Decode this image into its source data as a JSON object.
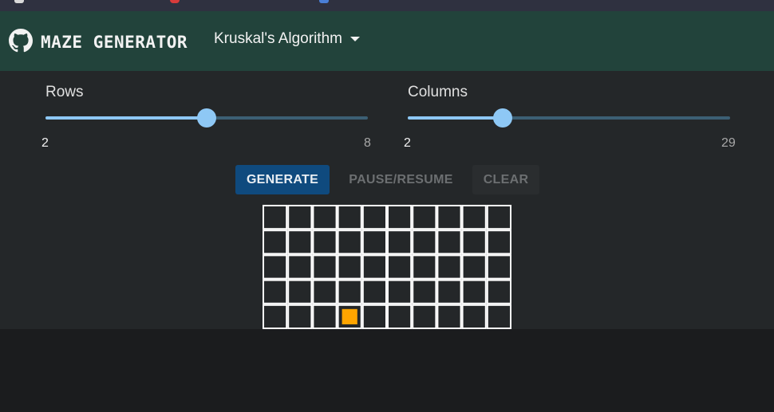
{
  "browser": {
    "tab_icons": [
      {
        "name": "page-icon",
        "color": "#d9d9d9"
      },
      {
        "name": "record-icon",
        "color": "#d83b3b"
      },
      {
        "name": "doc-icon",
        "color": "#4a7fd6"
      }
    ]
  },
  "header": {
    "brand": "MAZE GENERATOR",
    "algorithm": "Kruskal's Algorithm",
    "logo_icon": "github-icon",
    "background": "#22433b"
  },
  "sliders": {
    "rows": {
      "label": "Rows",
      "min": "2",
      "max": "8",
      "value": 5
    },
    "columns": {
      "label": "Columns",
      "min": "2",
      "max": "29",
      "value": 10
    }
  },
  "buttons": {
    "generate": "GENERATE",
    "pause_resume": "PAUSE/RESUME",
    "clear": "CLEAR"
  },
  "maze": {
    "rows": 5,
    "columns": 10,
    "highlight": {
      "row": 4,
      "column": 3
    },
    "highlight_color": "#ffa500",
    "wall_color": "#ffffff"
  },
  "colors": {
    "accent": "#8ec8f5",
    "primary_button": "#0f4a7e"
  }
}
